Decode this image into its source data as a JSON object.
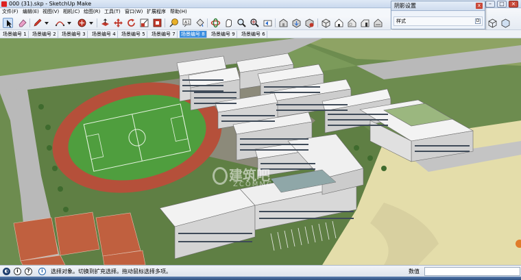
{
  "window": {
    "title": "000 (31).skp - SketchUp Make",
    "min_label": "–",
    "max_label": "□",
    "close_label": "×"
  },
  "menu": {
    "items": [
      "文件(F)",
      "编辑(E)",
      "视图(V)",
      "相机(C)",
      "绘图(R)",
      "工具(T)",
      "窗口(W)",
      "扩展程序",
      "帮助(H)"
    ]
  },
  "toolbar": {
    "tools": [
      "select-icon",
      "eraser-icon",
      "pencil-icon",
      "arc-icon",
      "shapes-icon",
      "push-pull-icon",
      "move-icon",
      "rotate-icon",
      "scale-icon",
      "offset-icon",
      "tape-measure-icon",
      "text-icon",
      "paint-bucket-icon",
      "orbit-icon",
      "pan-icon",
      "zoom-icon",
      "zoom-extents-icon",
      "previous-view-icon",
      "warehouse-icon",
      "share-model-icon",
      "extension-icon",
      "iso-view-icon",
      "top-view-icon",
      "front-view-icon",
      "right-view-icon",
      "back-view-icon",
      "left-view-icon"
    ],
    "right_tools": [
      "wireframe-icon",
      "xray-icon"
    ]
  },
  "scenes": {
    "tabs": [
      "场景编号 1",
      "场景编号 2",
      "场景编号 3",
      "场景编号 4",
      "场景编号 5",
      "场景编号 7",
      "场景编号 8",
      "场景编号 9",
      "场景编号 6"
    ],
    "active_index": 6
  },
  "shadow_panel": {
    "title": "阴影设置",
    "close_label": "x",
    "row_label": "样式",
    "expand_label": "D"
  },
  "watermark": {
    "text": "建筑吧",
    "sub": "ZCOMMC"
  },
  "status": {
    "message": "选择对象。切换到扩充选择。拖动鼠标选择多项。",
    "icons": [
      "geo-location-icon",
      "credits-icon",
      "help-icon"
    ],
    "icon_glyphs": [
      "◐",
      "i",
      "?"
    ],
    "vcb_label": "数值",
    "vcb_value": ""
  },
  "colors": {
    "grass": "#6d8c4f",
    "track": "#b5503a",
    "field": "#4f9e3e",
    "road": "#b9b9b9",
    "sand": "#e4ddaa",
    "building": "#eeeeee",
    "active_tab": "#3c8fe0"
  }
}
